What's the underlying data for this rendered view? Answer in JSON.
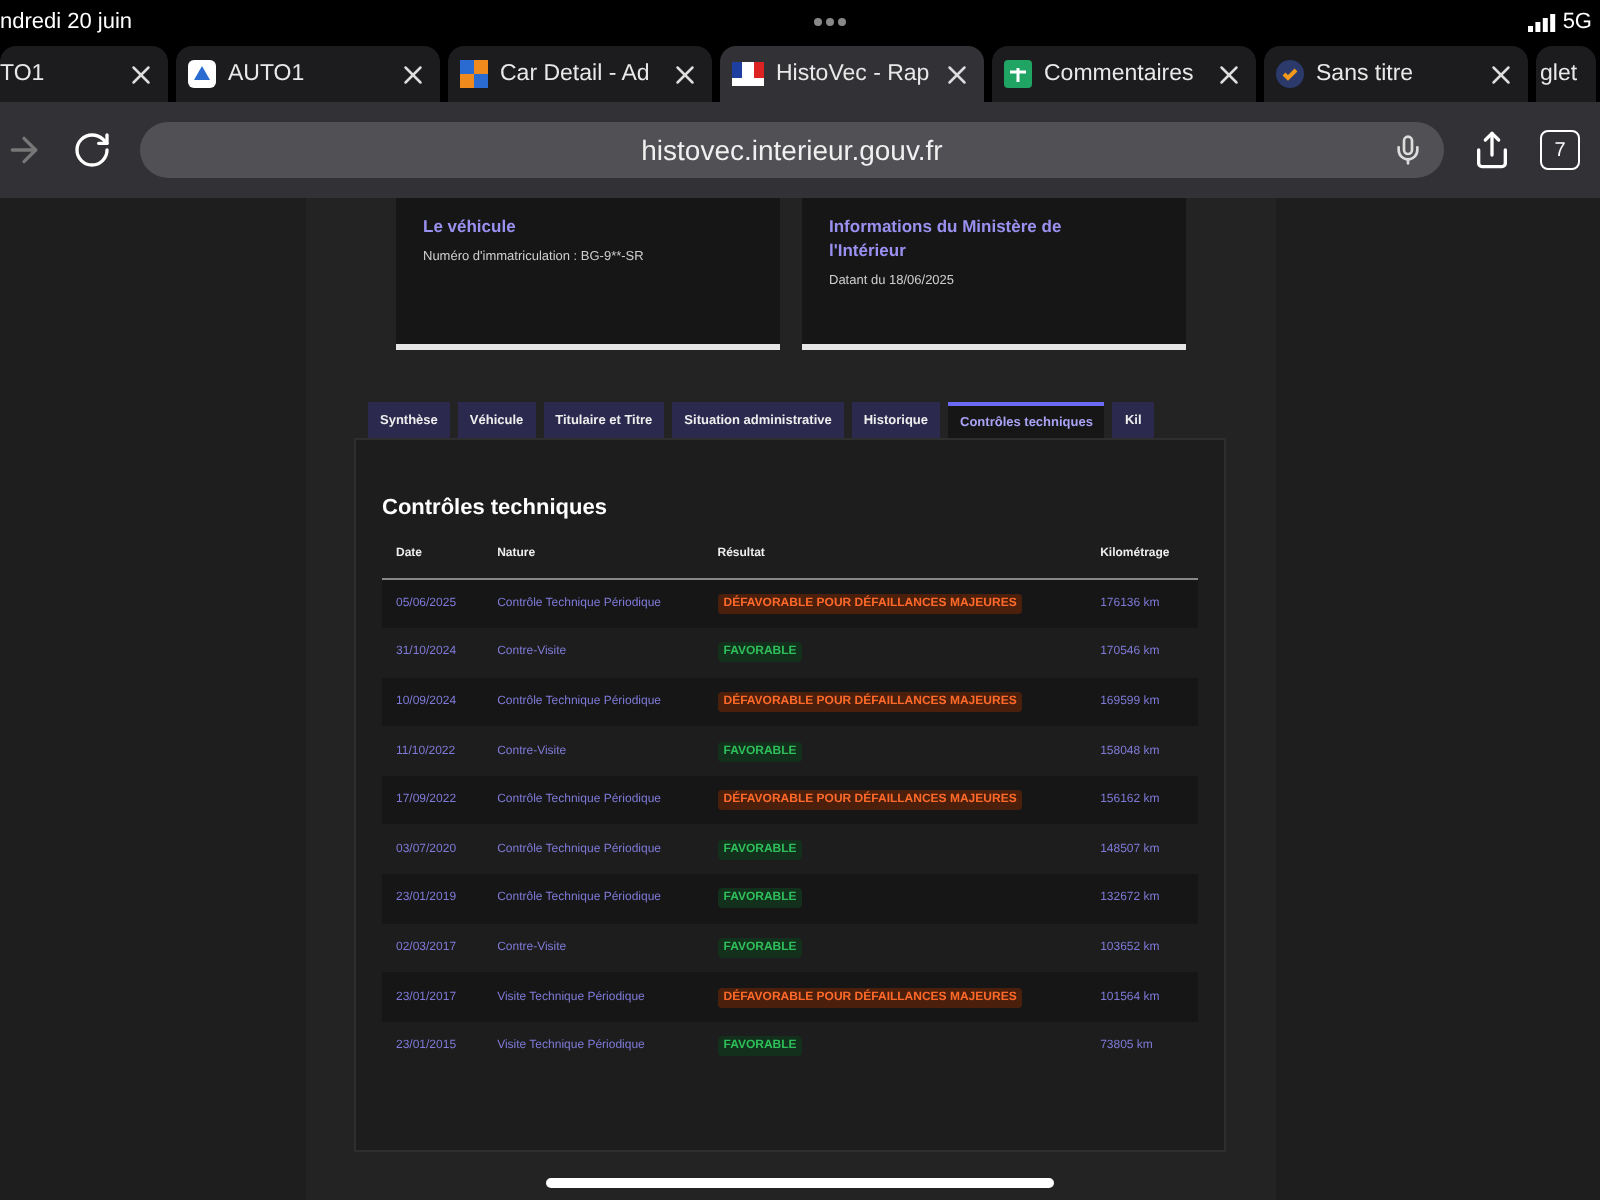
{
  "status_bar": {
    "time": "ndredi 20 juin",
    "network": "5G"
  },
  "browser_tabs": [
    {
      "title": "TO1",
      "kind": "plain",
      "selected": false
    },
    {
      "title": "AUTO1",
      "kind": "auto1",
      "selected": false
    },
    {
      "title": "Car Detail - Ad",
      "kind": "squares",
      "selected": false
    },
    {
      "title": "HistoVec - Rap",
      "kind": "flag",
      "selected": true
    },
    {
      "title": "Commentaires",
      "kind": "sheet",
      "selected": false
    },
    {
      "title": "Sans titre",
      "kind": "check",
      "selected": false
    },
    {
      "title": "glet",
      "kind": "plain",
      "selected": false
    }
  ],
  "address_bar": {
    "url": "histovec.interieur.gouv.fr",
    "tab_count": "7"
  },
  "cards": [
    {
      "title": "Le véhicule",
      "text": "Numéro d'immatriculation : BG-9**-SR"
    },
    {
      "title": "Informations du Ministère de l'Intérieur",
      "text": "Datant du 18/06/2025"
    }
  ],
  "report_tabs": [
    {
      "label": "Synthèse",
      "selected": false
    },
    {
      "label": "Véhicule",
      "selected": false
    },
    {
      "label": "Titulaire et Titre",
      "selected": false
    },
    {
      "label": "Situation administrative",
      "selected": false
    },
    {
      "label": "Historique",
      "selected": false
    },
    {
      "label": "Contrôles techniques",
      "selected": true
    },
    {
      "label": "Kil",
      "selected": false
    }
  ],
  "section": {
    "title": "Contrôles techniques",
    "columns": [
      "Date",
      "Nature",
      "Résultat",
      "Kilométrage"
    ],
    "rows": [
      {
        "date": "05/06/2025",
        "nature": "Contrôle Technique Périodique",
        "result": "DÉFAVORABLE POUR DÉFAILLANCES MAJEURES",
        "kind": "unfavorable",
        "mileage": "176136 km"
      },
      {
        "date": "31/10/2024",
        "nature": "Contre-Visite",
        "result": "FAVORABLE",
        "kind": "favorable",
        "mileage": "170546 km"
      },
      {
        "date": "10/09/2024",
        "nature": "Contrôle Technique Périodique",
        "result": "DÉFAVORABLE POUR DÉFAILLANCES MAJEURES",
        "kind": "unfavorable",
        "mileage": "169599 km"
      },
      {
        "date": "11/10/2022",
        "nature": "Contre-Visite",
        "result": "FAVORABLE",
        "kind": "favorable",
        "mileage": "158048 km"
      },
      {
        "date": "17/09/2022",
        "nature": "Contrôle Technique Périodique",
        "result": "DÉFAVORABLE POUR DÉFAILLANCES MAJEURES",
        "kind": "unfavorable",
        "mileage": "156162 km"
      },
      {
        "date": "03/07/2020",
        "nature": "Contrôle Technique Périodique",
        "result": "FAVORABLE",
        "kind": "favorable",
        "mileage": "148507 km"
      },
      {
        "date": "23/01/2019",
        "nature": "Contrôle Technique Périodique",
        "result": "FAVORABLE",
        "kind": "favorable",
        "mileage": "132672 km"
      },
      {
        "date": "02/03/2017",
        "nature": "Contre-Visite",
        "result": "FAVORABLE",
        "kind": "favorable",
        "mileage": "103652 km"
      },
      {
        "date": "23/01/2017",
        "nature": "Visite Technique Périodique",
        "result": "DÉFAVORABLE POUR DÉFAILLANCES MAJEURES",
        "kind": "unfavorable",
        "mileage": "101564 km"
      },
      {
        "date": "23/01/2015",
        "nature": "Visite Technique Périodique",
        "result": "FAVORABLE",
        "kind": "favorable",
        "mileage": "73805 km"
      }
    ]
  }
}
